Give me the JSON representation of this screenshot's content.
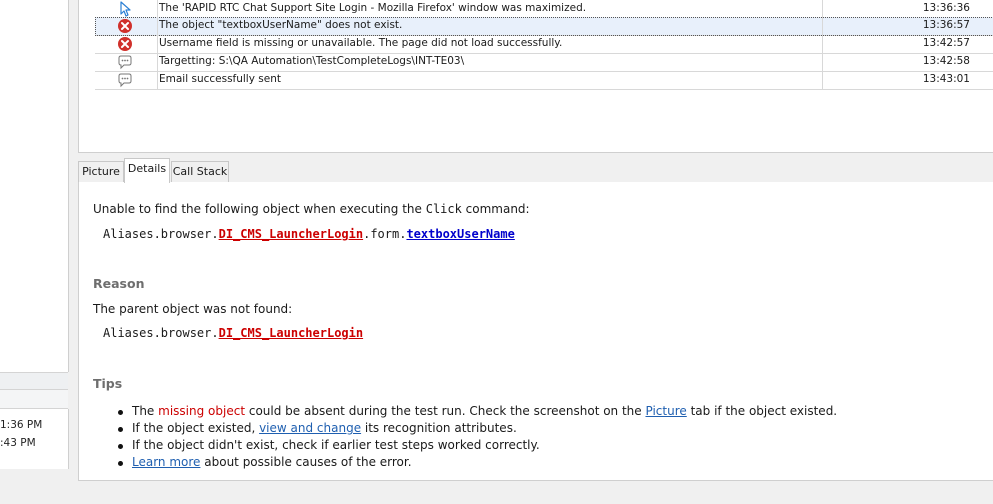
{
  "left": {
    "times": [
      "1:36 PM",
      ":43 PM"
    ]
  },
  "log": {
    "rows": [
      {
        "icon": "cursor-icon",
        "message": "The 'RAPID RTC Chat Support Site Login - Mozilla Firefox' window was maximized.",
        "time": "13:36:36",
        "selected": false
      },
      {
        "icon": "error-icon",
        "message": "The object \"textboxUserName\" does not exist.",
        "time": "13:36:57",
        "selected": true
      },
      {
        "icon": "error-icon",
        "message": "Username field is missing or unavailable. The page did not load successfully.",
        "time": "13:42:57",
        "selected": false
      },
      {
        "icon": "comment-icon",
        "message": "Targetting: S:\\QA Automation\\TestCompleteLogs\\INT-TE03\\",
        "time": "13:42:58",
        "selected": false
      },
      {
        "icon": "comment-icon",
        "message": "Email successfully sent",
        "time": "13:43:01",
        "selected": false
      }
    ]
  },
  "tabs": {
    "picture": "Picture",
    "details": "Details",
    "call_stack": "Call Stack",
    "active": "Details"
  },
  "details": {
    "intro_prefix": "Unable to find the following object when executing the ",
    "intro_command": "Click",
    "intro_suffix": " command:",
    "path_prefix": "Aliases.browser.",
    "path_missing": "DI_CMS_LauncherLogin",
    "path_mid": ".form.",
    "path_object": "textboxUserName",
    "reason_heading": "Reason",
    "reason_text": "The parent object was not found:",
    "reason_path_prefix": "Aliases.browser.",
    "reason_path_missing": "DI_CMS_LauncherLogin",
    "tips_heading": "Tips",
    "tip1_a": "The ",
    "tip1_b": "missing object",
    "tip1_c": " could be absent during the test run. Check the screenshot on the ",
    "tip1_link": "Picture",
    "tip1_d": " tab if the object existed.",
    "tip2_a": "If the object existed, ",
    "tip2_link": "view and change",
    "tip2_b": " its recognition attributes.",
    "tip3": "If the object didn't exist, check if earlier test steps worked correctly.",
    "tip4_link": "Learn more",
    "tip4_b": " about possible causes of the error."
  },
  "colors": {
    "error": "#d0302b",
    "link": "#1f5fb0",
    "missing": "#cc0000",
    "object": "#0000cc"
  }
}
